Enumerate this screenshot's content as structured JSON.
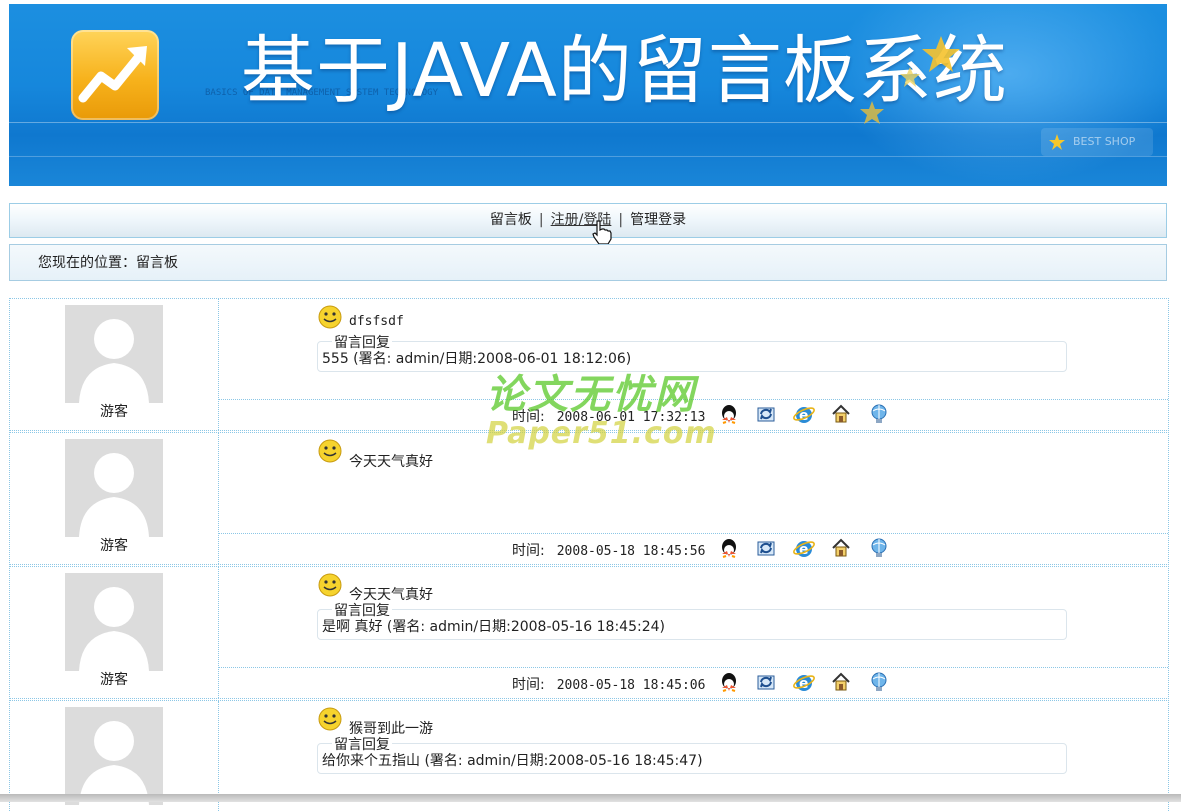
{
  "banner": {
    "title": "基于JAVA的留言板系统",
    "faint_text": "BASICS OF DATA MANAGEMENT SYSTEM TECHNOLOGY",
    "button_label": "BEST SHOP"
  },
  "nav": {
    "items": [
      "留言板",
      "注册/登陆",
      "管理登录"
    ],
    "separator": "|"
  },
  "location": {
    "text": "您现在的位置：留言板"
  },
  "messages": [
    {
      "user": "游客",
      "title": "dfsfsdf",
      "reply_label": "留言回复",
      "reply": "555 (署名: admin/日期:2008-06-01 18:12:06)",
      "time_label": "时间:",
      "time": "2008-06-01 17:32:13"
    },
    {
      "user": "游客",
      "title": "今天天气真好",
      "reply_label": "",
      "reply": "",
      "time_label": "时间:",
      "time": "2008-05-18 18:45:56"
    },
    {
      "user": "游客",
      "title": "今天天气真好",
      "reply_label": "留言回复",
      "reply": "是啊 真好 (署名: admin/日期:2008-05-16 18:45:24)",
      "time_label": "时间:",
      "time": "2008-05-18 18:45:06"
    },
    {
      "user": "",
      "title": "猴哥到此一游",
      "reply_label": "留言回复",
      "reply": "给你来个五指山 (署名: admin/日期:2008-05-16 18:45:47)",
      "time_label": "",
      "time": ""
    }
  ],
  "watermark": {
    "line1": "论文无忧网",
    "line2": "Paper51.com"
  },
  "icons": [
    "qq-icon",
    "refresh-icon",
    "ie-icon",
    "home-icon",
    "globe-icon"
  ]
}
